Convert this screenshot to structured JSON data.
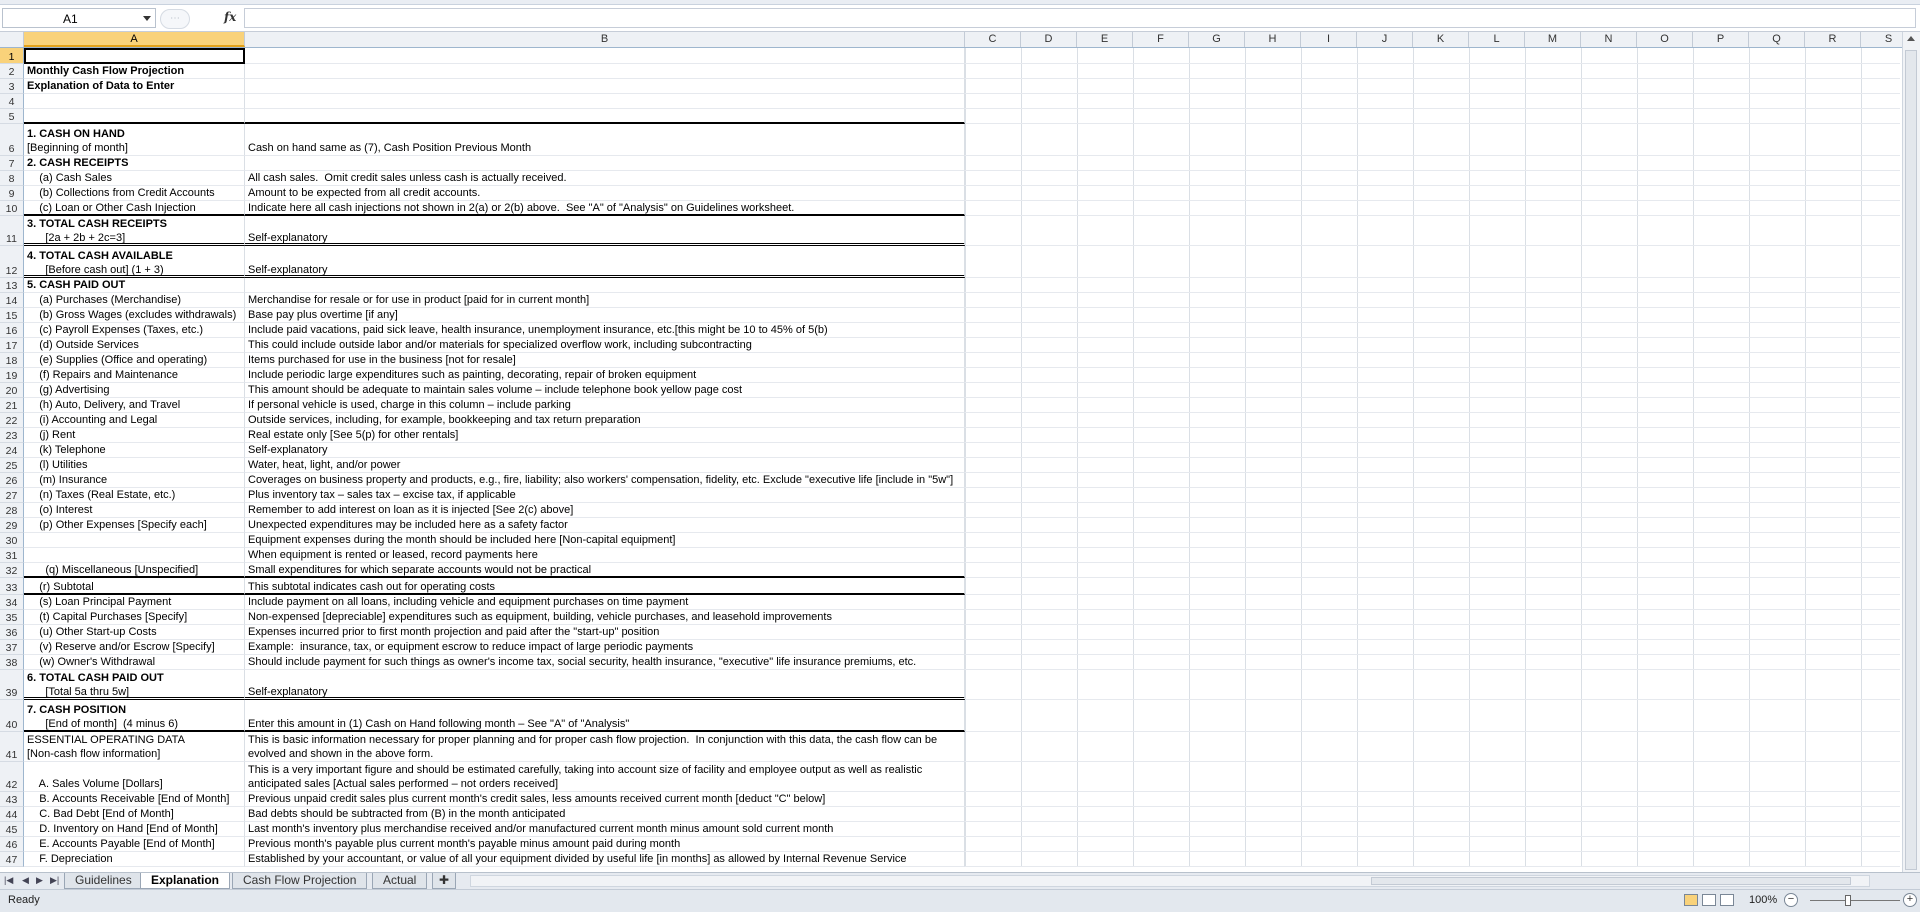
{
  "formula_bar": {
    "name_box": "A1",
    "fx_label": "fx",
    "formula": ""
  },
  "columns": [
    "A",
    "B",
    "C",
    "D",
    "E",
    "F",
    "G",
    "H",
    "I",
    "J",
    "K",
    "L",
    "M",
    "N",
    "O",
    "P",
    "Q",
    "R",
    "S"
  ],
  "rows": [
    {
      "n": "1",
      "h": 16,
      "a": [],
      "b": []
    },
    {
      "n": "2",
      "h": 15,
      "a": [
        "Monthly Cash Flow Projection"
      ],
      "b": [],
      "bold": true
    },
    {
      "n": "3",
      "h": 15,
      "a": [
        "Explanation of Data to Enter"
      ],
      "b": [],
      "bold": true
    },
    {
      "n": "4",
      "h": 15,
      "a": [],
      "b": []
    },
    {
      "n": "5",
      "h": 15,
      "a": [],
      "b": [],
      "border": "thick"
    },
    {
      "n": "6",
      "h": 32,
      "a": [
        "1. CASH ON HAND",
        "[Beginning of month]"
      ],
      "b": [
        "",
        "Cash on hand same as (7), Cash Position Previous Month"
      ],
      "boldFirst": true
    },
    {
      "n": "7",
      "h": 15,
      "a": [
        "2. CASH RECEIPTS"
      ],
      "b": [],
      "bold": true
    },
    {
      "n": "8",
      "h": 15,
      "a": [
        "    (a) Cash Sales"
      ],
      "b": [
        "All cash sales.  Omit credit sales unless cash is actually received."
      ]
    },
    {
      "n": "9",
      "h": 15,
      "a": [
        "    (b) Collections from Credit Accounts"
      ],
      "b": [
        "Amount to be expected from all credit accounts."
      ]
    },
    {
      "n": "10",
      "h": 15,
      "a": [
        "    (c) Loan or Other Cash Injection"
      ],
      "b": [
        "Indicate here all cash injections not shown in 2(a) or 2(b) above.  See \"A\" of \"Analysis\" on Guidelines worksheet."
      ],
      "border": "thick"
    },
    {
      "n": "11",
      "h": 30,
      "a": [
        "3. TOTAL CASH RECEIPTS",
        "      [2a + 2b + 2c=3]"
      ],
      "b": [
        "",
        "Self-explanatory"
      ],
      "boldFirst": true,
      "border": "dbl"
    },
    {
      "n": "12",
      "h": 32,
      "a": [
        "4. TOTAL CASH AVAILABLE",
        "      [Before cash out] (1 + 3)"
      ],
      "b": [
        "",
        "Self-explanatory"
      ],
      "boldFirst": true,
      "border": "dbl"
    },
    {
      "n": "13",
      "h": 15,
      "a": [
        "5. CASH PAID OUT"
      ],
      "b": [],
      "bold": true
    },
    {
      "n": "14",
      "h": 15,
      "a": [
        "    (a) Purchases (Merchandise)"
      ],
      "b": [
        "Merchandise for resale or for use in product [paid for in current month]"
      ]
    },
    {
      "n": "15",
      "h": 15,
      "a": [
        "    (b) Gross Wages (excludes withdrawals)"
      ],
      "b": [
        "Base pay plus overtime [if any]"
      ]
    },
    {
      "n": "16",
      "h": 15,
      "a": [
        "    (c) Payroll Expenses (Taxes, etc.)"
      ],
      "b": [
        "Include paid vacations, paid sick leave, health insurance, unemployment insurance, etc.[this might be 10 to 45% of 5(b)"
      ]
    },
    {
      "n": "17",
      "h": 15,
      "a": [
        "    (d) Outside Services"
      ],
      "b": [
        "This could include outside labor and/or materials for specialized overflow work, including subcontracting"
      ]
    },
    {
      "n": "18",
      "h": 15,
      "a": [
        "    (e) Supplies (Office and operating)"
      ],
      "b": [
        "Items purchased for use in the business [not for resale]"
      ]
    },
    {
      "n": "19",
      "h": 15,
      "a": [
        "    (f) Repairs and Maintenance"
      ],
      "b": [
        "Include periodic large expenditures such as painting, decorating, repair of broken equipment"
      ]
    },
    {
      "n": "20",
      "h": 15,
      "a": [
        "    (g) Advertising"
      ],
      "b": [
        "This amount should be adequate to maintain sales volume – include telephone book yellow page cost"
      ]
    },
    {
      "n": "21",
      "h": 15,
      "a": [
        "    (h) Auto, Delivery, and Travel"
      ],
      "b": [
        "If personal vehicle is used, charge in this column – include parking"
      ]
    },
    {
      "n": "22",
      "h": 15,
      "a": [
        "    (i) Accounting and Legal"
      ],
      "b": [
        "Outside services, including, for example, bookkeeping and tax return preparation"
      ]
    },
    {
      "n": "23",
      "h": 15,
      "a": [
        "    (j) Rent"
      ],
      "b": [
        "Real estate only [See 5(p) for other rentals]"
      ]
    },
    {
      "n": "24",
      "h": 15,
      "a": [
        "    (k) Telephone"
      ],
      "b": [
        "Self-explanatory"
      ]
    },
    {
      "n": "25",
      "h": 15,
      "a": [
        "    (l) Utilities"
      ],
      "b": [
        "Water, heat, light, and/or power"
      ]
    },
    {
      "n": "26",
      "h": 15,
      "a": [
        "    (m) Insurance"
      ],
      "b": [
        "Coverages on business property and products, e.g., fire, liability; also workers' compensation, fidelity, etc. Exclude \"executive life [include in \"5w\"]"
      ]
    },
    {
      "n": "27",
      "h": 15,
      "a": [
        "    (n) Taxes (Real Estate, etc.)"
      ],
      "b": [
        "Plus inventory tax – sales tax – excise tax, if applicable"
      ]
    },
    {
      "n": "28",
      "h": 15,
      "a": [
        "    (o) Interest"
      ],
      "b": [
        "Remember to add interest on loan as it is injected [See 2(c) above]"
      ]
    },
    {
      "n": "29",
      "h": 15,
      "a": [
        "    (p) Other Expenses [Specify each]"
      ],
      "b": [
        "Unexpected expenditures may be included here as a safety factor"
      ]
    },
    {
      "n": "30",
      "h": 15,
      "a": [],
      "b": [
        "Equipment expenses during the month should be included here [Non-capital equipment]"
      ]
    },
    {
      "n": "31",
      "h": 15,
      "a": [],
      "b": [
        "When equipment is rented or leased, record payments here"
      ]
    },
    {
      "n": "32",
      "h": 15,
      "a": [
        "      (q) Miscellaneous [Unspecified]"
      ],
      "b": [
        "Small expenditures for which separate accounts would not be practical"
      ],
      "border": "thick"
    },
    {
      "n": "33",
      "h": 17,
      "a": [
        "    (r) Subtotal"
      ],
      "b": [
        "This subtotal indicates cash out for operating costs"
      ],
      "border": "thick"
    },
    {
      "n": "34",
      "h": 15,
      "a": [
        "    (s) Loan Principal Payment"
      ],
      "b": [
        "Include payment on all loans, including vehicle and equipment purchases on time payment"
      ]
    },
    {
      "n": "35",
      "h": 15,
      "a": [
        "    (t) Capital Purchases [Specify]"
      ],
      "b": [
        "Non-expensed [depreciable] expenditures such as equipment, building, vehicle purchases, and leasehold improvements"
      ]
    },
    {
      "n": "36",
      "h": 15,
      "a": [
        "    (u) Other Start-up Costs"
      ],
      "b": [
        "Expenses incurred prior to first month projection and paid after the \"start-up\" position"
      ]
    },
    {
      "n": "37",
      "h": 15,
      "a": [
        "    (v) Reserve and/or Escrow [Specify]"
      ],
      "b": [
        "Example:  insurance, tax, or equipment escrow to reduce impact of large periodic payments"
      ]
    },
    {
      "n": "38",
      "h": 15,
      "a": [
        "    (w) Owner's Withdrawal"
      ],
      "b": [
        "Should include payment for such things as owner's income tax, social security, health insurance, \"executive\" life insurance premiums, etc."
      ]
    },
    {
      "n": "39",
      "h": 30,
      "a": [
        "6. TOTAL CASH PAID OUT",
        "      [Total 5a thru 5w]"
      ],
      "b": [
        "",
        "Self-explanatory"
      ],
      "boldFirst": true,
      "border": "dbl"
    },
    {
      "n": "40",
      "h": 32,
      "a": [
        "7. CASH POSITION",
        "      [End of month]  (4 minus 6)"
      ],
      "b": [
        "",
        "Enter this amount in (1) Cash on Hand following month – See \"A\" of \"Analysis\""
      ],
      "boldFirst": true,
      "border": "thick"
    },
    {
      "n": "41",
      "h": 30,
      "a": [
        "ESSENTIAL OPERATING DATA",
        "[Non-cash flow information]"
      ],
      "b": [
        "This is basic information necessary for proper planning and for proper cash flow projection.  In conjunction with this data, the cash flow can be",
        "evolved and shown in the above form."
      ]
    },
    {
      "n": "42",
      "h": 30,
      "a": [
        "",
        "    A. Sales Volume [Dollars]"
      ],
      "b": [
        "This is a very important figure and should be estimated carefully, taking into account size of facility and employee output as well as realistic",
        "anticipated sales [Actual sales performed – not orders received]"
      ]
    },
    {
      "n": "43",
      "h": 15,
      "a": [
        "    B. Accounts Receivable [End of Month]"
      ],
      "b": [
        "Previous unpaid credit sales plus current month's credit sales, less amounts received current month [deduct \"C\" below]"
      ]
    },
    {
      "n": "44",
      "h": 15,
      "a": [
        "    C. Bad Debt [End of Month]"
      ],
      "b": [
        "Bad debts should be subtracted from (B) in the month anticipated"
      ]
    },
    {
      "n": "45",
      "h": 15,
      "a": [
        "    D. Inventory on Hand [End of Month]"
      ],
      "b": [
        "Last month's inventory plus merchandise received and/or manufactured current month minus amount sold current month"
      ]
    },
    {
      "n": "46",
      "h": 15,
      "a": [
        "    E. Accounts Payable [End of Month]"
      ],
      "b": [
        "Previous month's payable plus current month's payable minus amount paid during month"
      ]
    },
    {
      "n": "47",
      "h": 15,
      "a": [
        "    F. Depreciation"
      ],
      "b": [
        "Established by your accountant, or value of all your equipment divided by useful life [in months] as allowed by Internal Revenue Service"
      ]
    }
  ],
  "sheet_tabs": [
    "Guidelines",
    "Explanation",
    "Cash Flow Projection",
    "Actual"
  ],
  "active_tab": "Explanation",
  "status": {
    "mode": "Ready",
    "zoom": "100%"
  }
}
